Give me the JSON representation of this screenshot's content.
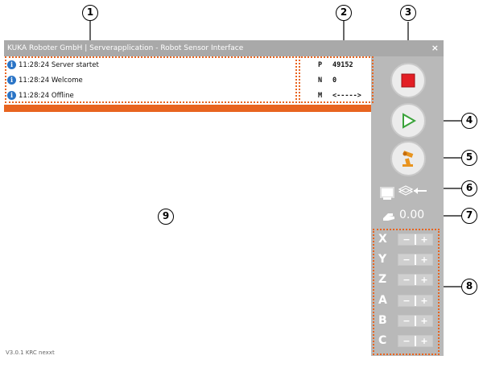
{
  "window": {
    "title": "KUKA Roboter GmbH | Serverapplication - Robot Sensor Interface",
    "close_glyph": "×",
    "version": "V3.0.1 KRC nexxt"
  },
  "log": [
    {
      "icon": "info-icon",
      "time": "11:28:24",
      "message": "Server startet"
    },
    {
      "icon": "info-icon",
      "time": "11:28:24",
      "message": "Welcome"
    },
    {
      "icon": "info-icon",
      "time": "11:28:24",
      "message": "Offline"
    }
  ],
  "status": {
    "port_key": "P",
    "port_value": "49152",
    "n_key": "N",
    "n_value": "0",
    "m_key": "M",
    "m_value": "<----->"
  },
  "controls": {
    "stop": "stop-icon",
    "start": "play-icon",
    "robot": "robot-arm-icon",
    "monitor": "monitor-icon",
    "layers": "layers-arrow-icon",
    "hand": "hand-icon",
    "velocity": "0.00"
  },
  "axes": [
    "X",
    "Y",
    "Z",
    "A",
    "B",
    "C"
  ],
  "stepper": {
    "minus": "−",
    "plus": "+"
  },
  "callouts": [
    "1",
    "2",
    "3",
    "4",
    "5",
    "6",
    "7",
    "8",
    "9"
  ],
  "colors": {
    "accent": "#e8641f",
    "stop_red": "#e31e24",
    "play_green": "#3aa33a",
    "info_blue": "#2a74c6"
  }
}
